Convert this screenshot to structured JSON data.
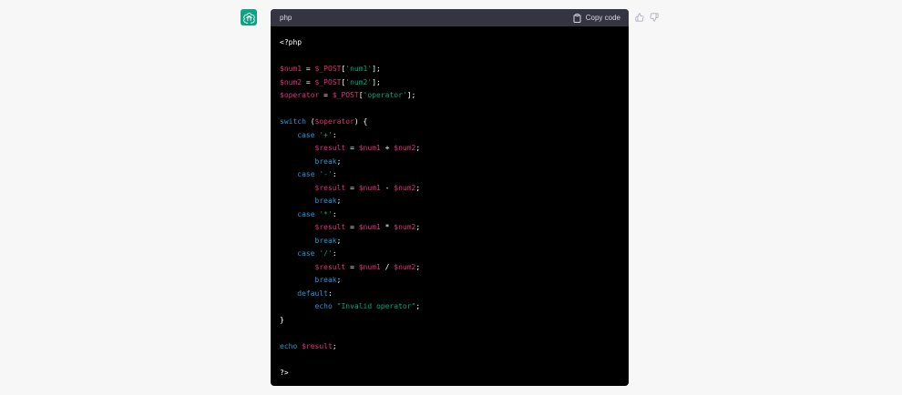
{
  "message": {
    "avatar_icon": "openai-logo-icon"
  },
  "code_block": {
    "language": "php",
    "copy_label": "Copy code",
    "copy_icon": "clipboard-icon",
    "lines": [
      [
        {
          "t": "<?php",
          "c": "plain"
        }
      ],
      [],
      [
        {
          "t": "$num1",
          "c": "var"
        },
        {
          "t": " = ",
          "c": "plain"
        },
        {
          "t": "$_POST",
          "c": "var"
        },
        {
          "t": "[",
          "c": "plain"
        },
        {
          "t": "'num1'",
          "c": "str"
        },
        {
          "t": "];",
          "c": "plain"
        }
      ],
      [
        {
          "t": "$num2",
          "c": "var"
        },
        {
          "t": " = ",
          "c": "plain"
        },
        {
          "t": "$_POST",
          "c": "var"
        },
        {
          "t": "[",
          "c": "plain"
        },
        {
          "t": "'num2'",
          "c": "str"
        },
        {
          "t": "];",
          "c": "plain"
        }
      ],
      [
        {
          "t": "$operator",
          "c": "var"
        },
        {
          "t": " = ",
          "c": "plain"
        },
        {
          "t": "$_POST",
          "c": "var"
        },
        {
          "t": "[",
          "c": "plain"
        },
        {
          "t": "'operator'",
          "c": "str"
        },
        {
          "t": "];",
          "c": "plain"
        }
      ],
      [],
      [
        {
          "t": "switch",
          "c": "kw"
        },
        {
          "t": " (",
          "c": "plain"
        },
        {
          "t": "$operator",
          "c": "var"
        },
        {
          "t": ") {",
          "c": "plain"
        }
      ],
      [
        {
          "t": "    ",
          "c": "plain"
        },
        {
          "t": "case",
          "c": "kw"
        },
        {
          "t": " ",
          "c": "plain"
        },
        {
          "t": "'+'",
          "c": "str"
        },
        {
          "t": ":",
          "c": "plain"
        }
      ],
      [
        {
          "t": "        ",
          "c": "plain"
        },
        {
          "t": "$result",
          "c": "var"
        },
        {
          "t": " = ",
          "c": "plain"
        },
        {
          "t": "$num1",
          "c": "var"
        },
        {
          "t": " + ",
          "c": "plain"
        },
        {
          "t": "$num2",
          "c": "var"
        },
        {
          "t": ";",
          "c": "plain"
        }
      ],
      [
        {
          "t": "        ",
          "c": "plain"
        },
        {
          "t": "break",
          "c": "kw"
        },
        {
          "t": ";",
          "c": "plain"
        }
      ],
      [
        {
          "t": "    ",
          "c": "plain"
        },
        {
          "t": "case",
          "c": "kw"
        },
        {
          "t": " ",
          "c": "plain"
        },
        {
          "t": "'-'",
          "c": "str"
        },
        {
          "t": ":",
          "c": "plain"
        }
      ],
      [
        {
          "t": "        ",
          "c": "plain"
        },
        {
          "t": "$result",
          "c": "var"
        },
        {
          "t": " = ",
          "c": "plain"
        },
        {
          "t": "$num1",
          "c": "var"
        },
        {
          "t": " - ",
          "c": "plain"
        },
        {
          "t": "$num2",
          "c": "var"
        },
        {
          "t": ";",
          "c": "plain"
        }
      ],
      [
        {
          "t": "        ",
          "c": "plain"
        },
        {
          "t": "break",
          "c": "kw"
        },
        {
          "t": ";",
          "c": "plain"
        }
      ],
      [
        {
          "t": "    ",
          "c": "plain"
        },
        {
          "t": "case",
          "c": "kw"
        },
        {
          "t": " ",
          "c": "plain"
        },
        {
          "t": "'*'",
          "c": "str"
        },
        {
          "t": ":",
          "c": "plain"
        }
      ],
      [
        {
          "t": "        ",
          "c": "plain"
        },
        {
          "t": "$result",
          "c": "var"
        },
        {
          "t": " = ",
          "c": "plain"
        },
        {
          "t": "$num1",
          "c": "var"
        },
        {
          "t": " * ",
          "c": "plain"
        },
        {
          "t": "$num2",
          "c": "var"
        },
        {
          "t": ";",
          "c": "plain"
        }
      ],
      [
        {
          "t": "        ",
          "c": "plain"
        },
        {
          "t": "break",
          "c": "kw"
        },
        {
          "t": ";",
          "c": "plain"
        }
      ],
      [
        {
          "t": "    ",
          "c": "plain"
        },
        {
          "t": "case",
          "c": "kw"
        },
        {
          "t": " ",
          "c": "plain"
        },
        {
          "t": "'/'",
          "c": "str"
        },
        {
          "t": ":",
          "c": "plain"
        }
      ],
      [
        {
          "t": "        ",
          "c": "plain"
        },
        {
          "t": "$result",
          "c": "var"
        },
        {
          "t": " = ",
          "c": "plain"
        },
        {
          "t": "$num1",
          "c": "var"
        },
        {
          "t": " / ",
          "c": "plain"
        },
        {
          "t": "$num2",
          "c": "var"
        },
        {
          "t": ";",
          "c": "plain"
        }
      ],
      [
        {
          "t": "        ",
          "c": "plain"
        },
        {
          "t": "break",
          "c": "kw"
        },
        {
          "t": ";",
          "c": "plain"
        }
      ],
      [
        {
          "t": "    ",
          "c": "plain"
        },
        {
          "t": "default",
          "c": "kw"
        },
        {
          "t": ":",
          "c": "plain"
        }
      ],
      [
        {
          "t": "        ",
          "c": "plain"
        },
        {
          "t": "echo",
          "c": "kw"
        },
        {
          "t": " ",
          "c": "plain"
        },
        {
          "t": "\"Invalid operator\"",
          "c": "str"
        },
        {
          "t": ";",
          "c": "plain"
        }
      ],
      [
        {
          "t": "}",
          "c": "plain"
        }
      ],
      [],
      [
        {
          "t": "echo",
          "c": "kw"
        },
        {
          "t": " ",
          "c": "plain"
        },
        {
          "t": "$result",
          "c": "var"
        },
        {
          "t": ";",
          "c": "plain"
        }
      ],
      [],
      [
        {
          "t": "?>",
          "c": "plain"
        }
      ]
    ]
  },
  "feedback": {
    "thumbs_up_icon": "thumbs-up-icon",
    "thumbs_down_icon": "thumbs-down-icon"
  },
  "colors": {
    "page_background": "#f7f7f8",
    "avatar": "#10a37f",
    "code_background": "#000000",
    "code_header": "#343541",
    "variable": "#df3079",
    "keyword": "#2e95d3",
    "string": "#00a67d",
    "plain": "#ffffff"
  }
}
